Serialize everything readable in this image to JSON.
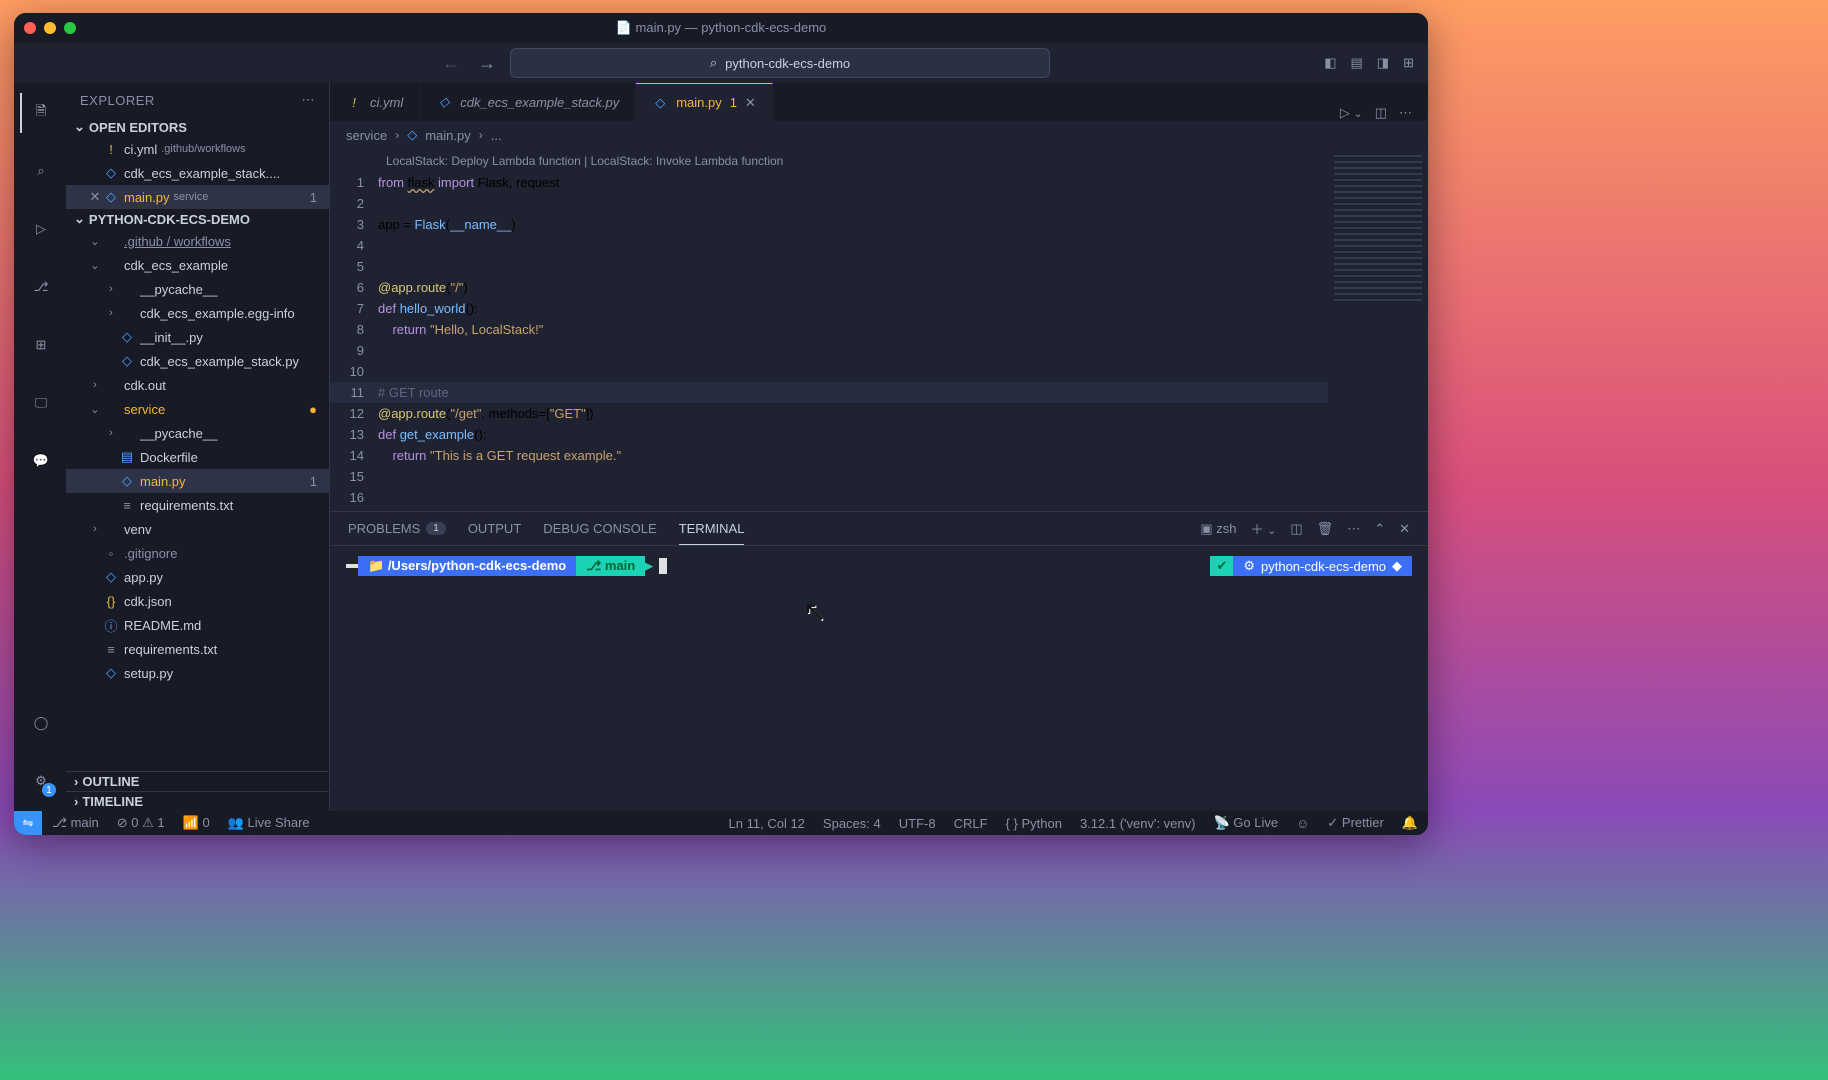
{
  "window_title": "main.py — python-cdk-ecs-demo",
  "search_placeholder": "python-cdk-ecs-demo",
  "explorer": {
    "title": "EXPLORER",
    "open_editors_label": "OPEN EDITORS",
    "open_editors": [
      {
        "name": "ci.yml",
        "detail": ".github/workflows",
        "icon": "!",
        "color": "#d9ba3c"
      },
      {
        "name": "cdk_ecs_example_stack....",
        "detail": "",
        "icon": "◇",
        "color": "#4fa1ff"
      },
      {
        "name": "main.py",
        "detail": "service",
        "icon": "◇",
        "color": "#4fa1ff",
        "active": true,
        "count": "1"
      }
    ],
    "project_label": "PYTHON-CDK-ECS-DEMO",
    "tree": [
      {
        "depth": 1,
        "caret": "v",
        "icon": "",
        "name": ".github / workflows",
        "dim": true,
        "underline": true
      },
      {
        "depth": 1,
        "caret": "v",
        "icon": "",
        "name": "cdk_ecs_example"
      },
      {
        "depth": 2,
        "caret": ">",
        "icon": "",
        "name": "__pycache__"
      },
      {
        "depth": 2,
        "caret": ">",
        "icon": "",
        "name": "cdk_ecs_example.egg-info"
      },
      {
        "depth": 2,
        "caret": "",
        "icon": "◇",
        "name": "__init__.py",
        "ic": "#4fa1ff"
      },
      {
        "depth": 2,
        "caret": "",
        "icon": "◇",
        "name": "cdk_ecs_example_stack.py",
        "ic": "#4fa1ff"
      },
      {
        "depth": 1,
        "caret": ">",
        "icon": "",
        "name": "cdk.out"
      },
      {
        "depth": 1,
        "caret": "v",
        "icon": "",
        "name": "service",
        "mod": true,
        "color": "#f5b638"
      },
      {
        "depth": 2,
        "caret": ">",
        "icon": "",
        "name": "__pycache__"
      },
      {
        "depth": 2,
        "caret": "",
        "icon": "▤",
        "name": "Dockerfile",
        "ic": "#4fa1ff"
      },
      {
        "depth": 2,
        "caret": "",
        "icon": "◇",
        "name": "main.py",
        "ic": "#4fa1ff",
        "active": true,
        "count": "1",
        "color": "#f5b638"
      },
      {
        "depth": 2,
        "caret": "",
        "icon": "≡",
        "name": "requirements.txt",
        "ic": "#8a91a6"
      },
      {
        "depth": 1,
        "caret": ">",
        "icon": "",
        "name": "venv"
      },
      {
        "depth": 1,
        "caret": "",
        "icon": "◦",
        "name": ".gitignore",
        "ic": "#8a91a6",
        "dim": true
      },
      {
        "depth": 1,
        "caret": "",
        "icon": "◇",
        "name": "app.py",
        "ic": "#4fa1ff"
      },
      {
        "depth": 1,
        "caret": "",
        "icon": "{}",
        "name": "cdk.json",
        "ic": "#d9ba3c"
      },
      {
        "depth": 1,
        "caret": "",
        "icon": "ⓘ",
        "name": "README.md",
        "ic": "#4fa1ff"
      },
      {
        "depth": 1,
        "caret": "",
        "icon": "≡",
        "name": "requirements.txt",
        "ic": "#8a91a6"
      },
      {
        "depth": 1,
        "caret": "",
        "icon": "◇",
        "name": "setup.py",
        "ic": "#4fa1ff"
      }
    ],
    "outline": "OUTLINE",
    "timeline": "TIMELINE"
  },
  "editor_tabs": [
    {
      "name": "ci.yml",
      "icon": "!",
      "ic": "#d9ba3c"
    },
    {
      "name": "cdk_ecs_example_stack.py",
      "icon": "◇",
      "ic": "#4fa1ff"
    },
    {
      "name": "main.py",
      "icon": "◇",
      "ic": "#4fa1ff",
      "active": true,
      "badge": "1"
    }
  ],
  "breadcrumbs": [
    "service",
    "main.py",
    "..."
  ],
  "codelens": "LocalStack: Deploy Lambda function | LocalStack: Invoke Lambda function",
  "code_lines": [
    {
      "n": "1",
      "html": "<span class='kw'>from</span> <span class='squig'>flask</span> <span class='kw'>import</span> Flask, request"
    },
    {
      "n": "2",
      "html": ""
    },
    {
      "n": "3",
      "html": "app = <span class='fn'>Flask</span>(<span class='fn'>__name__</span>)"
    },
    {
      "n": "4",
      "html": ""
    },
    {
      "n": "5",
      "html": ""
    },
    {
      "n": "6",
      "html": "<span class='deco'>@app.route</span>(<span class='str'>\"/\"</span>)"
    },
    {
      "n": "7",
      "html": "<span class='kw'>def</span> <span class='fn'>hello_world</span>():"
    },
    {
      "n": "8",
      "html": "    <span class='kw'>return</span> <span class='str'>\"Hello, LocalStack!\"</span>"
    },
    {
      "n": "9",
      "html": ""
    },
    {
      "n": "10",
      "html": ""
    },
    {
      "n": "11",
      "html": "<span class='cm'># GET route</span>",
      "hl": true
    },
    {
      "n": "12",
      "html": "<span class='deco'>@app.route</span>(<span class='str'>\"/get\"</span>, <span>methods</span>=[<span class='str'>\"GET\"</span>])"
    },
    {
      "n": "13",
      "html": "<span class='kw'>def</span> <span class='fn'>get_example</span>():"
    },
    {
      "n": "14",
      "html": "    <span class='kw'>return</span> <span class='str'>\"This is a GET request example.\"</span>"
    },
    {
      "n": "15",
      "html": ""
    },
    {
      "n": "16",
      "html": ""
    }
  ],
  "panel": {
    "tabs": {
      "problems": "PROBLEMS",
      "problems_count": "1",
      "output": "OUTPUT",
      "debug": "DEBUG CONSOLE",
      "terminal": "TERMINAL"
    },
    "shell_name": "zsh"
  },
  "terminal": {
    "path": "/Users/python-cdk-ecs-demo",
    "branch": "main",
    "env": "python-cdk-ecs-demo"
  },
  "status": {
    "branch": "main",
    "errors": "0",
    "warnings": "1",
    "ports": "0",
    "liveshare": "Live Share",
    "pos": "Ln 11, Col 12",
    "spaces": "Spaces: 4",
    "encoding": "UTF-8",
    "eol": "CRLF",
    "lang": "Python",
    "interpreter": "3.12.1 ('venv': venv)",
    "golive": "Go Live",
    "prettier": "Prettier"
  }
}
